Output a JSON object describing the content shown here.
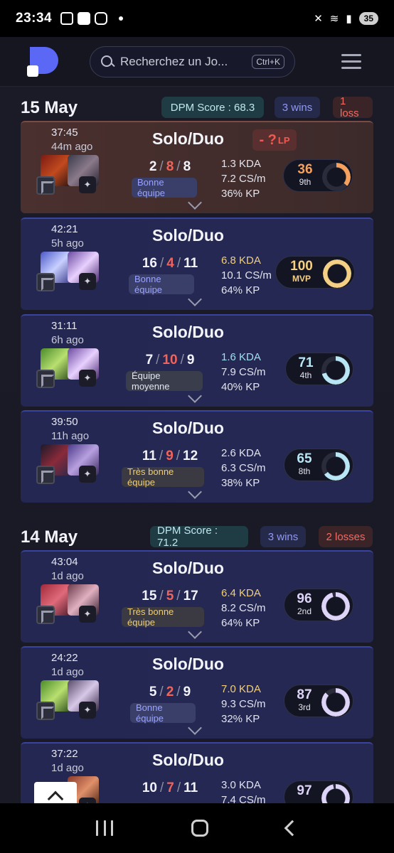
{
  "status_bar": {
    "time": "23:34",
    "battery": "35"
  },
  "header": {
    "search_placeholder": "Recherchez un Jo...",
    "search_shortcut": "Ctrl+K"
  },
  "days": [
    {
      "title": "15 May",
      "dpm_score": "DPM Score : 68.3",
      "wins": "3 wins",
      "losses": "1 loss",
      "games": [
        {
          "duration": "37:45",
          "ago": "44m ago",
          "mode": "Solo/Duo",
          "lp": "- ?",
          "lp_unit": "LP",
          "kills": "2",
          "deaths": "8",
          "assists": "8",
          "team": "Bonne équipe",
          "kda": "1.3 KDA",
          "cs": "7.2 CS/m",
          "kp": "36% KP",
          "score": "36",
          "rank": "9th",
          "result": "loss"
        },
        {
          "duration": "42:21",
          "ago": "5h ago",
          "mode": "Solo/Duo",
          "kills": "16",
          "deaths": "4",
          "assists": "11",
          "team": "Bonne équipe",
          "kda": "6.8 KDA",
          "cs": "10.1 CS/m",
          "kp": "64% KP",
          "score": "100",
          "rank": "MVP",
          "result": "win"
        },
        {
          "duration": "31:11",
          "ago": "6h ago",
          "mode": "Solo/Duo",
          "kills": "7",
          "deaths": "10",
          "assists": "9",
          "team": "Équipe moyenne",
          "kda": "1.6 KDA",
          "cs": "7.9 CS/m",
          "kp": "40% KP",
          "score": "71",
          "rank": "4th",
          "result": "win"
        },
        {
          "duration": "39:50",
          "ago": "11h ago",
          "mode": "Solo/Duo",
          "kills": "11",
          "deaths": "9",
          "assists": "12",
          "team": "Très bonne équipe",
          "kda": "2.6 KDA",
          "cs": "6.3 CS/m",
          "kp": "38% KP",
          "score": "65",
          "rank": "8th",
          "result": "win"
        }
      ]
    },
    {
      "title": "14 May",
      "dpm_score": "DPM Score : 71.2",
      "wins": "3 wins",
      "losses": "2 losses",
      "games": [
        {
          "duration": "43:04",
          "ago": "1d ago",
          "mode": "Solo/Duo",
          "kills": "15",
          "deaths": "5",
          "assists": "17",
          "team": "Très bonne équipe",
          "kda": "6.4 KDA",
          "cs": "8.2 CS/m",
          "kp": "64% KP",
          "score": "96",
          "rank": "2nd",
          "result": "win"
        },
        {
          "duration": "24:22",
          "ago": "1d ago",
          "mode": "Solo/Duo",
          "kills": "5",
          "deaths": "2",
          "assists": "9",
          "team": "Bonne équipe",
          "kda": "7.0 KDA",
          "cs": "9.3 CS/m",
          "kp": "32% KP",
          "score": "87",
          "rank": "3rd",
          "result": "win"
        },
        {
          "duration": "37:22",
          "ago": "1d ago",
          "mode": "Solo/Duo",
          "kills": "10",
          "deaths": "7",
          "assists": "11",
          "kda": "3.0 KDA",
          "cs": "7.4 CS/m",
          "score": "97",
          "result": "win"
        }
      ]
    }
  ],
  "colors": {
    "accent": "#5b67f5",
    "win_card": "#232752",
    "loss_card": "#4a302e",
    "gold": "#f2cf7a",
    "death_red": "#f0645c"
  }
}
